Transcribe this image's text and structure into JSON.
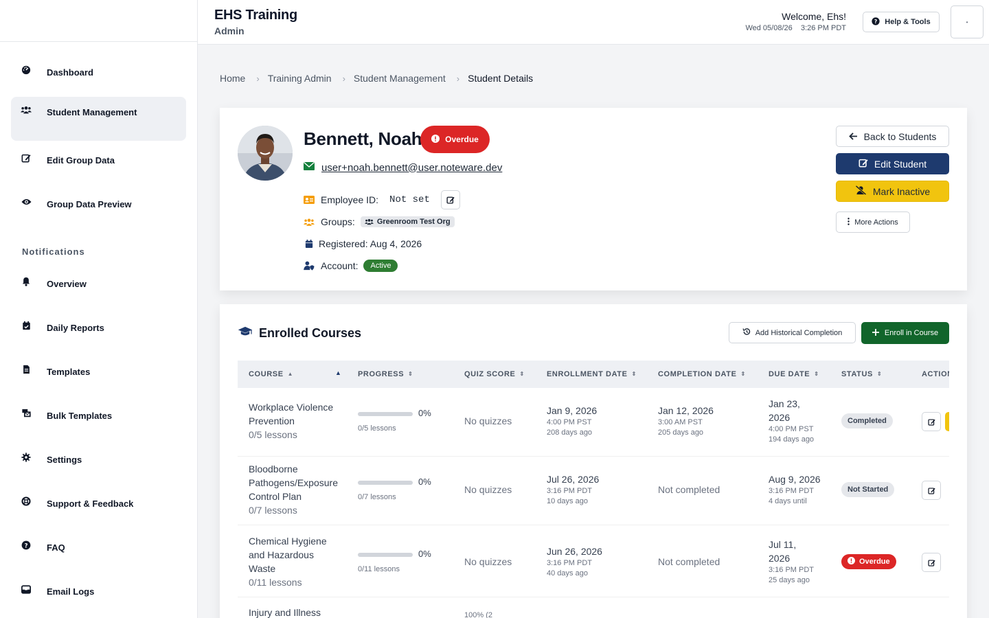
{
  "header": {
    "title": "EHS Training",
    "subtitle": "Admin",
    "welcome": "Welcome, Ehs!",
    "datetime": "Wed 05/08/26    3:26 PM PDT",
    "help_label": "Help & Tools",
    "corner_label": "•"
  },
  "sidebar": {
    "items": [
      {
        "label": "Dashboard",
        "icon": "gauge-icon"
      },
      {
        "label": "Student Management",
        "icon": "users-icon"
      },
      {
        "label": "Edit Group Data",
        "icon": "edit-icon"
      },
      {
        "label": "Group Data Preview",
        "icon": "eye-icon"
      }
    ],
    "section_title": "Notifications",
    "notif_items": [
      {
        "label": "Overview",
        "icon": "bell-icon"
      },
      {
        "label": "Daily Reports",
        "icon": "calendar-check-icon"
      },
      {
        "label": "Templates",
        "icon": "file-icon"
      },
      {
        "label": "Bulk Templates",
        "icon": "mail-bulk-icon"
      },
      {
        "label": "Settings",
        "icon": "gear-icon"
      },
      {
        "label": "Support & Feedback",
        "icon": "lifebuoy-icon"
      },
      {
        "label": "FAQ",
        "icon": "question-icon"
      },
      {
        "label": "Email Logs",
        "icon": "inbox-icon"
      }
    ]
  },
  "breadcrumb": [
    "Home",
    "Training Admin",
    "Student Management",
    "Student Details"
  ],
  "student": {
    "name": "Bennett, Noah",
    "status_badge": "Overdue",
    "email": "user+noah.bennett@user.noteware.dev",
    "employee_id_label": "Employee ID:",
    "employee_id_value": "Not set",
    "groups_label": "Groups:",
    "group_name": "Greenroom Test Org",
    "registered": "Registered: Aug 4, 2026",
    "account_label": "Account:",
    "account_status": "Active"
  },
  "actions": {
    "back": "Back to Students",
    "edit": "Edit Student",
    "inactive": "Mark Inactive",
    "more": "More Actions"
  },
  "courses": {
    "title": "Enrolled Courses",
    "add_historical": "Add Historical Completion",
    "enroll": "Enroll in Course",
    "columns": [
      "COURSE",
      "PROGRESS",
      "QUIZ SCORE",
      "ENROLLMENT DATE",
      "COMPLETION DATE",
      "DUE DATE",
      "STATUS",
      "ACTION"
    ],
    "rows": [
      {
        "course_lines": [
          "Workplace Violence",
          "Prevention"
        ],
        "lessons": "0/5 lessons",
        "progress_pct": "0%",
        "progress_sub": "0/5 lessons",
        "quiz": "No quizzes",
        "enroll_date": "Jan 9, 2026",
        "enroll_time": "4:00 PM PST",
        "enroll_ago": "208 days ago",
        "completion_date": "Jan 12, 2026",
        "completion_time": "3:00 AM PST",
        "completion_ago": "205 days ago",
        "due_lines": [
          "Jan 23,",
          "2026"
        ],
        "due_time": "4:00 PM PST",
        "due_ago": "194 days ago",
        "status": "Completed"
      },
      {
        "course_lines": [
          "Bloodborne",
          "Pathogens/Exposure",
          "Control Plan"
        ],
        "lessons": "0/7 lessons",
        "progress_pct": "0%",
        "progress_sub": "0/7 lessons",
        "quiz": "No quizzes",
        "enroll_date": "Jul 26, 2026",
        "enroll_time": "3:16 PM PDT",
        "enroll_ago": "10 days ago",
        "completion_text": "Not completed",
        "due_lines": [
          "Aug 9, 2026"
        ],
        "due_time": "3:16 PM PDT",
        "due_ago": "4 days until",
        "status": "Not Started"
      },
      {
        "course_lines": [
          "Chemical Hygiene",
          "and Hazardous",
          "Waste"
        ],
        "lessons": "0/11 lessons",
        "progress_pct": "0%",
        "progress_sub": "0/11 lessons",
        "quiz": "No quizzes",
        "enroll_date": "Jun 26, 2026",
        "enroll_time": "3:16 PM PDT",
        "enroll_ago": "40 days ago",
        "completion_text": "Not completed",
        "due_lines": [
          "Jul 11,",
          "2026"
        ],
        "due_time": "3:16 PM PDT",
        "due_ago": "25 days ago",
        "status": "Overdue"
      },
      {
        "course_lines": [
          "Injury and Illness"
        ],
        "quiz_partial": "100% (2"
      }
    ]
  },
  "colors": {
    "navy": "#1e3a6e",
    "overdue_red": "#dc2626",
    "warning_yellow": "#f1c40f",
    "success_green": "#11652b",
    "active_green": "#2e7d32"
  }
}
